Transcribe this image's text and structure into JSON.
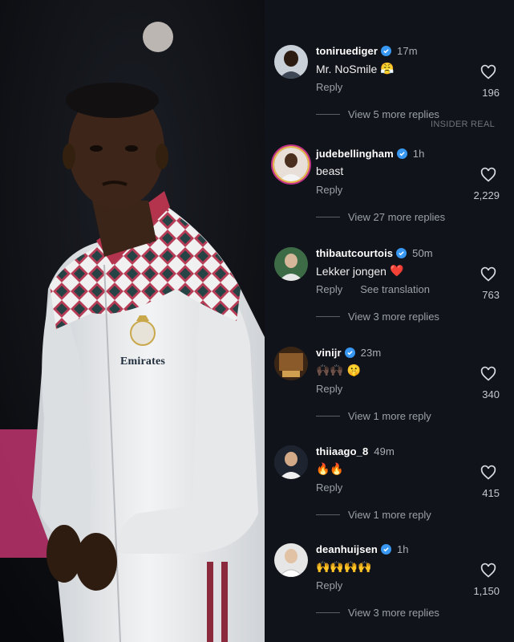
{
  "watermark": "INSIDER REAL",
  "photo": {
    "crest_text": "Emirates"
  },
  "ui": {
    "reply_label": "Reply",
    "translate_label": "See translation"
  },
  "comments": [
    {
      "username": "toniruediger",
      "time": "17m",
      "text": "Mr. NoSmile",
      "emoji": "😤",
      "likes": "196",
      "more": "View 5 more replies",
      "verified": true
    },
    {
      "username": "judebellingham",
      "time": "1h",
      "text": "beast",
      "emoji": "",
      "likes": "2,229",
      "more": "View 27 more replies",
      "verified": true
    },
    {
      "username": "thibautcourtois",
      "time": "50m",
      "text": "Lekker jongen",
      "emoji": "❤️",
      "likes": "763",
      "more": "View 3 more replies",
      "verified": true
    },
    {
      "username": "vinijr",
      "time": "23m",
      "text": "",
      "emoji": "🙌🏿🙌🏿 🤫",
      "likes": "340",
      "more": "View 1 more reply",
      "verified": true
    },
    {
      "username": "thiiaago_8",
      "time": "49m",
      "text": "",
      "emoji": "🔥🔥",
      "likes": "415",
      "more": "View 1 more reply",
      "verified": false
    },
    {
      "username": "deanhuijsen",
      "time": "1h",
      "text": "",
      "emoji": "🙌🙌🙌🙌",
      "likes": "1,150",
      "more": "View 3 more replies",
      "verified": true
    }
  ],
  "colors": {
    "verified": "#3897f0",
    "background": "#101319",
    "heart": "#ff3040"
  }
}
